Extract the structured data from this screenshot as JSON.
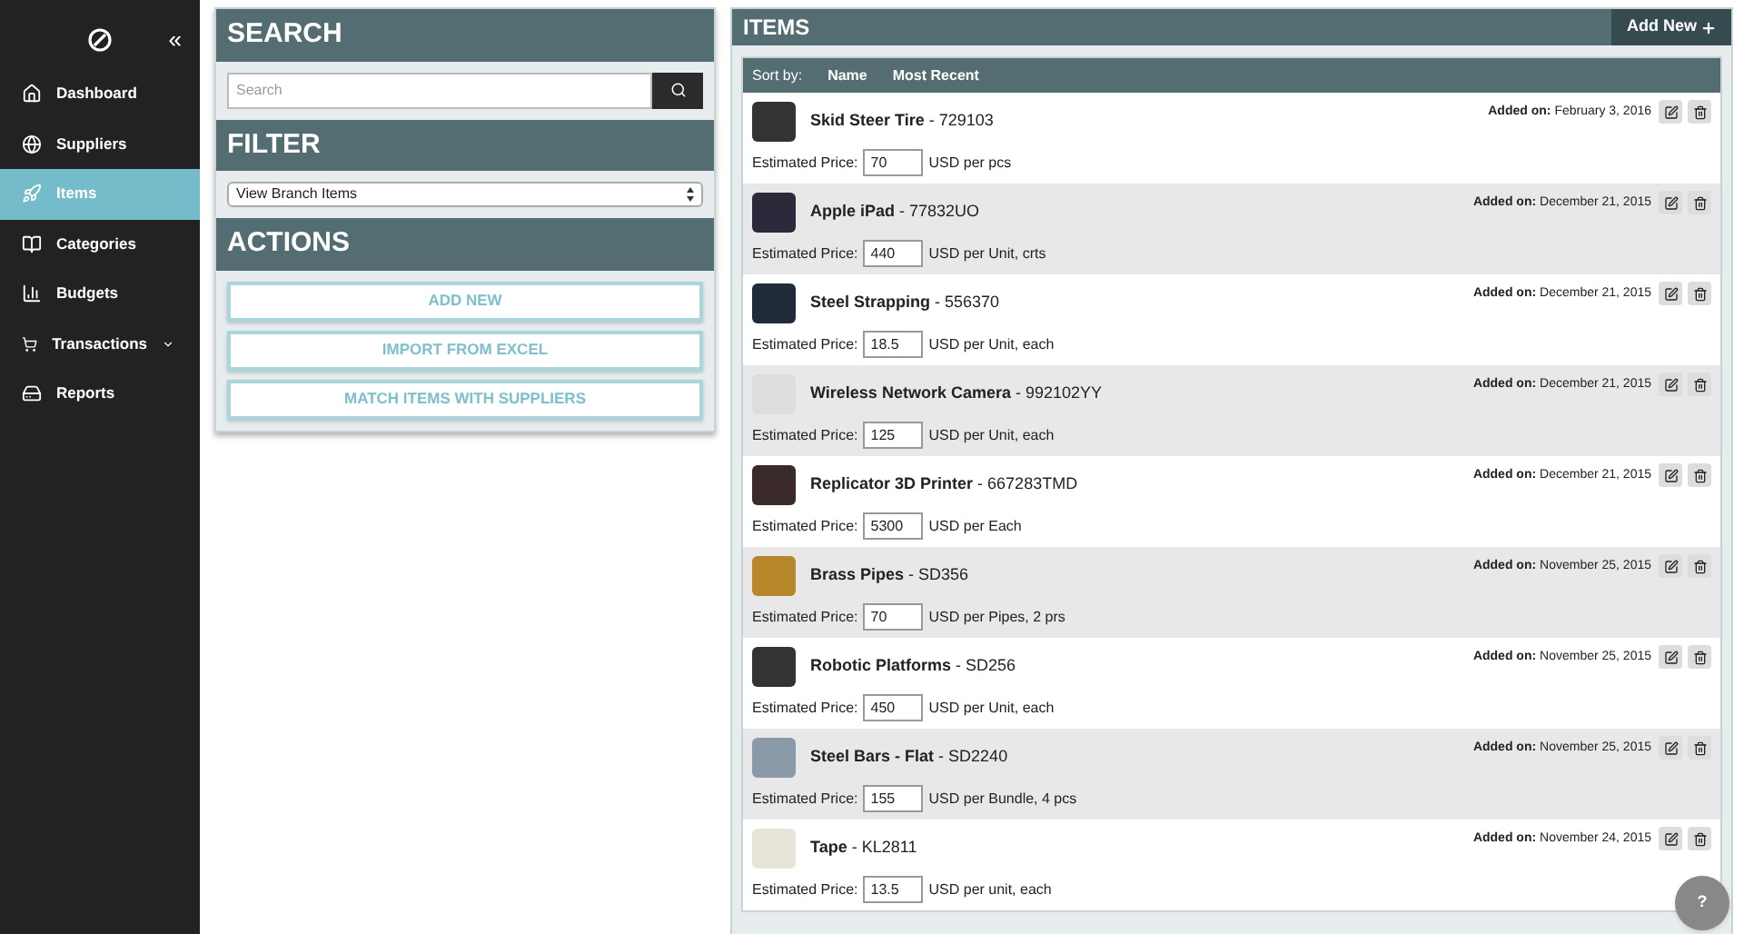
{
  "sidebar": {
    "collapse_glyph": "«",
    "items": [
      {
        "label": "Dashboard",
        "selected": false,
        "has_submenu": false
      },
      {
        "label": "Suppliers",
        "selected": false,
        "has_submenu": false
      },
      {
        "label": "Items",
        "selected": true,
        "has_submenu": false
      },
      {
        "label": "Categories",
        "selected": false,
        "has_submenu": false
      },
      {
        "label": "Budgets",
        "selected": false,
        "has_submenu": false
      },
      {
        "label": "Transactions",
        "selected": false,
        "has_submenu": true
      },
      {
        "label": "Reports",
        "selected": false,
        "has_submenu": false
      }
    ]
  },
  "search": {
    "title": "SEARCH",
    "placeholder": "Search"
  },
  "filter": {
    "title": "FILTER",
    "value": "View Branch Items"
  },
  "actions": {
    "title": "ACTIONS",
    "buttons": [
      "ADD NEW",
      "IMPORT FROM EXCEL",
      "MATCH ITEMS WITH SUPPLIERS"
    ]
  },
  "items": {
    "title": "ITEMS",
    "add_button": "Add New",
    "sort_label": "Sort by:",
    "sort_options": [
      "Name",
      "Most Recent"
    ],
    "rows": [
      {
        "name": "Skid Steer Tire",
        "code": "- 729103",
        "added_label": "Added on:",
        "price_label": "Estimated Price:",
        "date": "February 3, 2016",
        "price": "70",
        "unit": "USD per pcs"
      },
      {
        "name": "Apple iPad",
        "code": "- 77832UO",
        "added_label": "Added on:",
        "price_label": "Estimated Price:",
        "date": "December 21, 2015",
        "price": "440",
        "unit": "USD per Unit, crts"
      },
      {
        "name": "Steel Strapping",
        "code": "- 556370",
        "added_label": "Added on:",
        "price_label": "Estimated Price:",
        "date": "December 21, 2015",
        "price": "18.5",
        "unit": "USD per Unit, each"
      },
      {
        "name": "Wireless Network Camera",
        "code": "- 992102YY",
        "added_label": "Added on:",
        "price_label": "Estimated Price:",
        "date": "December 21, 2015",
        "price": "125",
        "unit": "USD per Unit, each"
      },
      {
        "name": "Replicator 3D Printer",
        "code": "- 667283TMD",
        "added_label": "Added on:",
        "price_label": "Estimated Price:",
        "date": "December 21, 2015",
        "price": "5300",
        "unit": "USD per Each"
      },
      {
        "name": "Brass Pipes",
        "code": "- SD356",
        "added_label": "Added on:",
        "price_label": "Estimated Price:",
        "date": "November 25, 2015",
        "price": "70",
        "unit": "USD per Pipes, 2 prs"
      },
      {
        "name": "Robotic Platforms",
        "code": "- SD256",
        "added_label": "Added on:",
        "price_label": "Estimated Price:",
        "date": "November 25, 2015",
        "price": "450",
        "unit": "USD per Unit, each"
      },
      {
        "name": "Steel Bars - Flat",
        "code": "- SD2240",
        "added_label": "Added on:",
        "price_label": "Estimated Price:",
        "date": "November 25, 2015",
        "price": "155",
        "unit": "USD per Bundle, 4 pcs"
      },
      {
        "name": "Tape",
        "code": "- KL2811",
        "added_label": "Added on:",
        "price_label": "Estimated Price:",
        "date": "November 24, 2015",
        "price": "13.5",
        "unit": "USD per unit, each"
      }
    ]
  },
  "help_glyph": "?"
}
